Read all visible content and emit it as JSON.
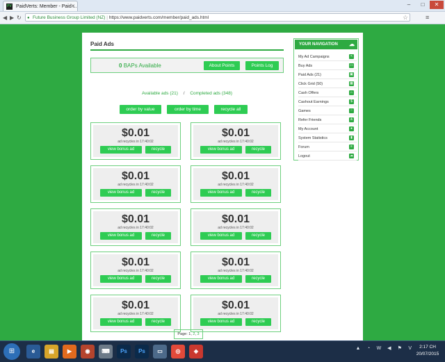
{
  "browser": {
    "tab_title": "PaidVerts: Member - Paid ...",
    "favicon_text": "PV",
    "org": "Future Business Group Limited (NZ)",
    "url": "https://www.paidverts.com/member/paid_ads.html"
  },
  "page": {
    "title": "Paid Ads",
    "bap_count": "0",
    "bap_label": "BAPs Available",
    "about_points": "About Points",
    "points_log": "Points Log",
    "available_ads": "Available ads (21)",
    "slash": "/",
    "completed_ads": "Completed ads (348)",
    "sort_buttons": [
      "order by value",
      "order by time",
      "recycle all"
    ]
  },
  "ads": [
    {
      "amount": "$0.01",
      "recycle_text": "ad recycles in 17:40:02",
      "view_label": "view bonus ad",
      "recycle_label": "recycle"
    },
    {
      "amount": "$0.01",
      "recycle_text": "ad recycles in 17:40:02",
      "view_label": "view bonus ad",
      "recycle_label": "recycle"
    },
    {
      "amount": "$0.01",
      "recycle_text": "ad recycles in 17:40:02",
      "view_label": "view bonus ad",
      "recycle_label": "recycle"
    },
    {
      "amount": "$0.01",
      "recycle_text": "ad recycles in 17:40:02",
      "view_label": "view bonus ad",
      "recycle_label": "recycle"
    },
    {
      "amount": "$0.01",
      "recycle_text": "ad recycles in 17:40:02",
      "view_label": "view bonus ad",
      "recycle_label": "recycle"
    },
    {
      "amount": "$0.01",
      "recycle_text": "ad recycles in 17:40:02",
      "view_label": "view bonus ad",
      "recycle_label": "recycle"
    },
    {
      "amount": "$0.01",
      "recycle_text": "ad recycles in 17:40:02",
      "view_label": "view bonus ad",
      "recycle_label": "recycle"
    },
    {
      "amount": "$0.01",
      "recycle_text": "ad recycles in 17:40:02",
      "view_label": "view bonus ad",
      "recycle_label": "recycle"
    },
    {
      "amount": "$0.01",
      "recycle_text": "ad recycles in 17:40:02",
      "view_label": "view bonus ad",
      "recycle_label": "recycle"
    },
    {
      "amount": "$0.01",
      "recycle_text": "ad recycles in 17:40:02",
      "view_label": "view bonus ad",
      "recycle_label": "recycle"
    }
  ],
  "pager": {
    "label": "Page:",
    "current": "1",
    "pages": [
      "2",
      "3"
    ]
  },
  "navigation": {
    "title": "YOUR NAVIGATION",
    "items": [
      {
        "label": "My Ad Campaigns",
        "icon": "share-icon"
      },
      {
        "label": "Buy Ads",
        "icon": "card-icon"
      },
      {
        "label": "Paid Ads (21)",
        "icon": "image-icon"
      },
      {
        "label": "Click Grid (50)",
        "icon": "grid-icon"
      },
      {
        "label": "Cash Offers",
        "icon": "home-icon"
      },
      {
        "label": "Cashout Earnings",
        "icon": "dollar-icon"
      },
      {
        "label": "Games",
        "icon": "dice-icon"
      },
      {
        "label": "Refer Friends",
        "icon": "network-icon"
      },
      {
        "label": "My Account",
        "icon": "user-icon"
      },
      {
        "label": "System Statistics",
        "icon": "chart-icon"
      },
      {
        "label": "Forum",
        "icon": "book-icon"
      },
      {
        "label": "Logout",
        "icon": "cloud-icon"
      }
    ]
  },
  "taskbar": {
    "time": "2:17 CH",
    "date": "20/07/2015",
    "icons": [
      "explorer-icon",
      "folder-icon",
      "media-player-icon",
      "firefox-icon",
      "keyboard-icon",
      "photoshop-icon",
      "photoshop-icon",
      "window-icon",
      "chrome-icon",
      "app-icon"
    ]
  }
}
